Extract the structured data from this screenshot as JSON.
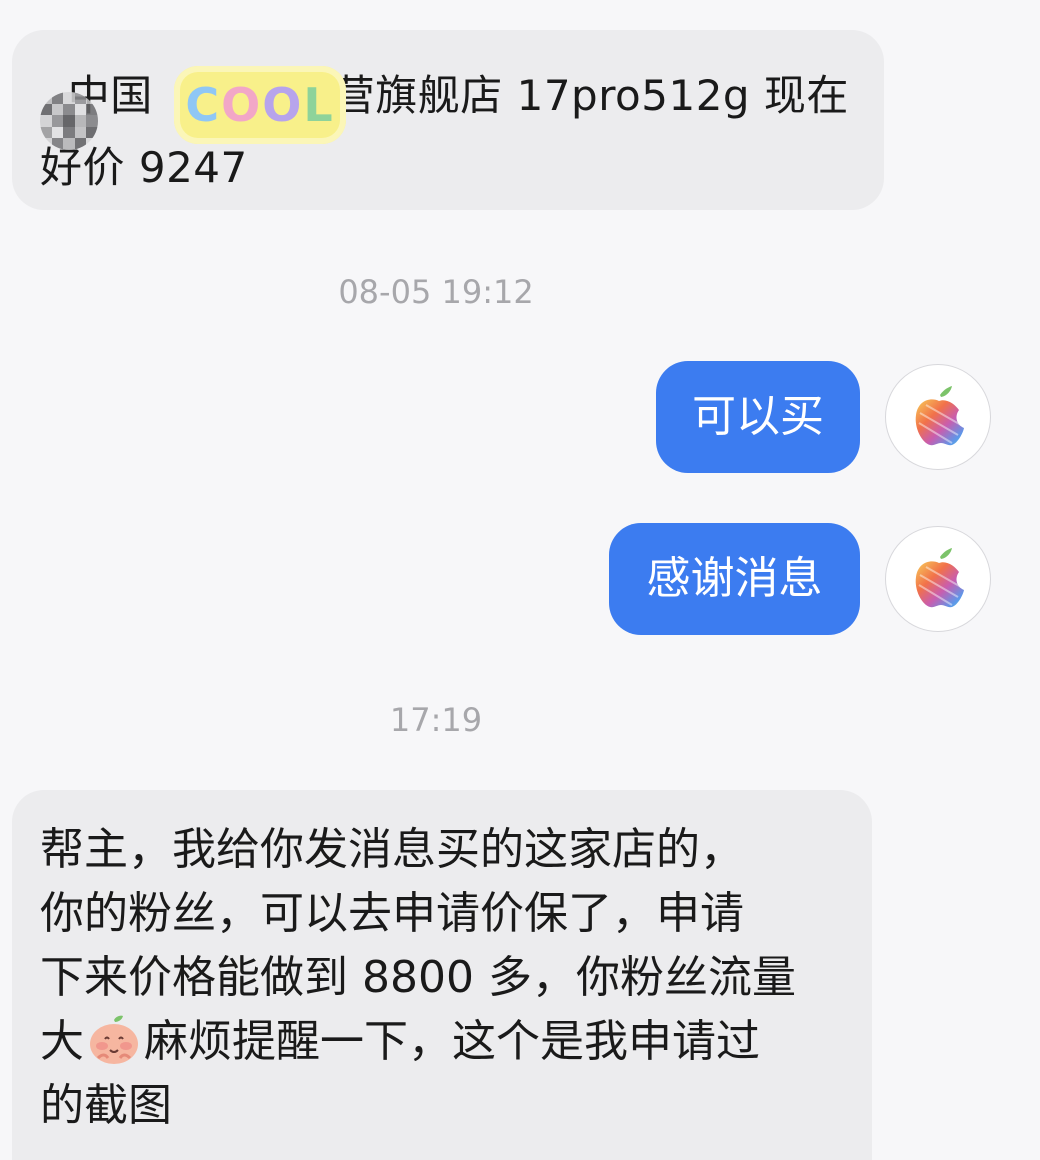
{
  "messages": {
    "msg1": {
      "text": "  中国             营旗舰店 17pro512g 现在\n好价 9247",
      "sticker_text": [
        "C",
        "O",
        "O",
        "L"
      ]
    },
    "timestamp1": "08-05 19:12",
    "msg2": {
      "text": "可以买"
    },
    "msg3": {
      "text": "感谢消息"
    },
    "timestamp2": "17:19",
    "msg4": {
      "line1": "帮主，我给你发消息买的这家店的，",
      "line2": "你的粉丝，可以去申请价保了，申请",
      "line3": "下来价格能做到 8800 多，你粉丝流量",
      "line4a": "大",
      "line4b": "麻烦提醒一下，这个是我申请过",
      "line5": "的截图"
    }
  },
  "icons": {
    "avatar": "rainbow-apple-logo-icon",
    "emoji": "peach-blushing-emoji-icon",
    "sticker": "cool-sticker-icon",
    "mosaic": "pixelated-avatar-icon"
  },
  "colors": {
    "background": "#f7f7f9",
    "incoming_bubble": "#ececee",
    "outgoing_bubble": "#3c7cf0",
    "timestamp": "#a7a7ab"
  }
}
